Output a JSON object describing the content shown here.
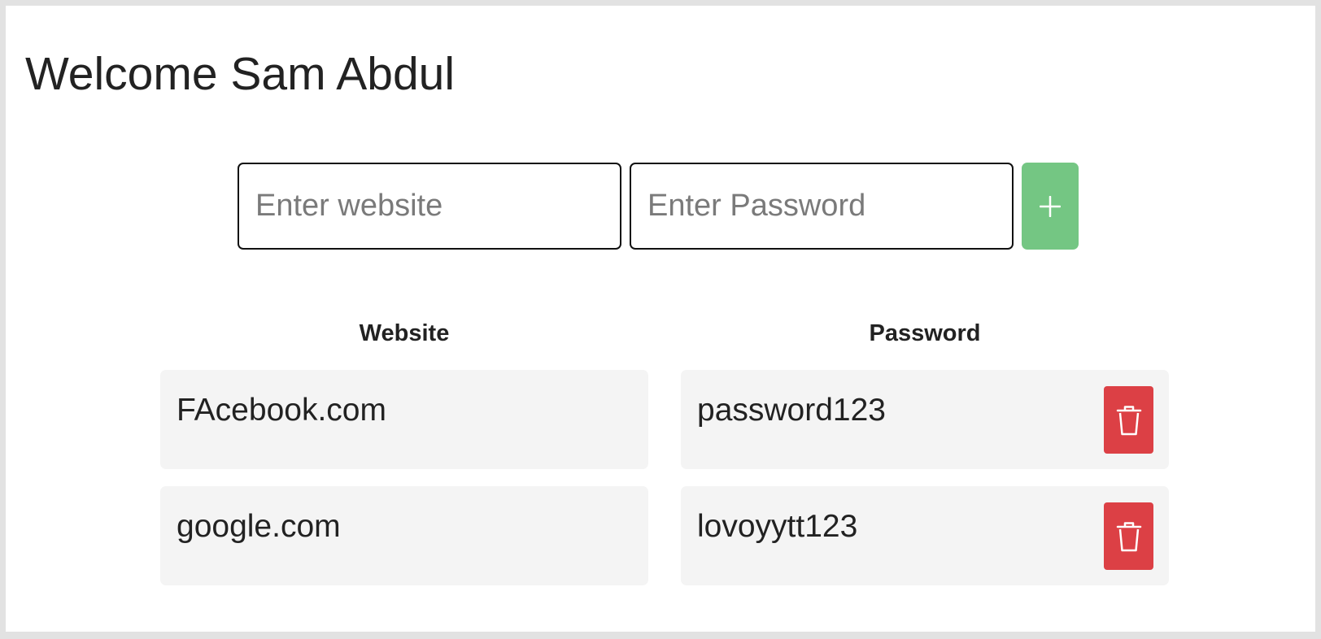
{
  "header": {
    "title": "Welcome Sam Abdul"
  },
  "form": {
    "website_placeholder": "Enter website",
    "password_placeholder": "Enter Password",
    "add_icon": "plus-icon"
  },
  "table": {
    "columns": [
      "Website",
      "Password"
    ],
    "rows": [
      {
        "website": "FAcebook.com",
        "password": "password123",
        "action_icon": "trash-icon"
      },
      {
        "website": "google.com",
        "password": "lovoyytt123",
        "action_icon": "trash-icon"
      }
    ]
  },
  "colors": {
    "add_button": "#74c683",
    "delete_button": "#dc4045"
  }
}
